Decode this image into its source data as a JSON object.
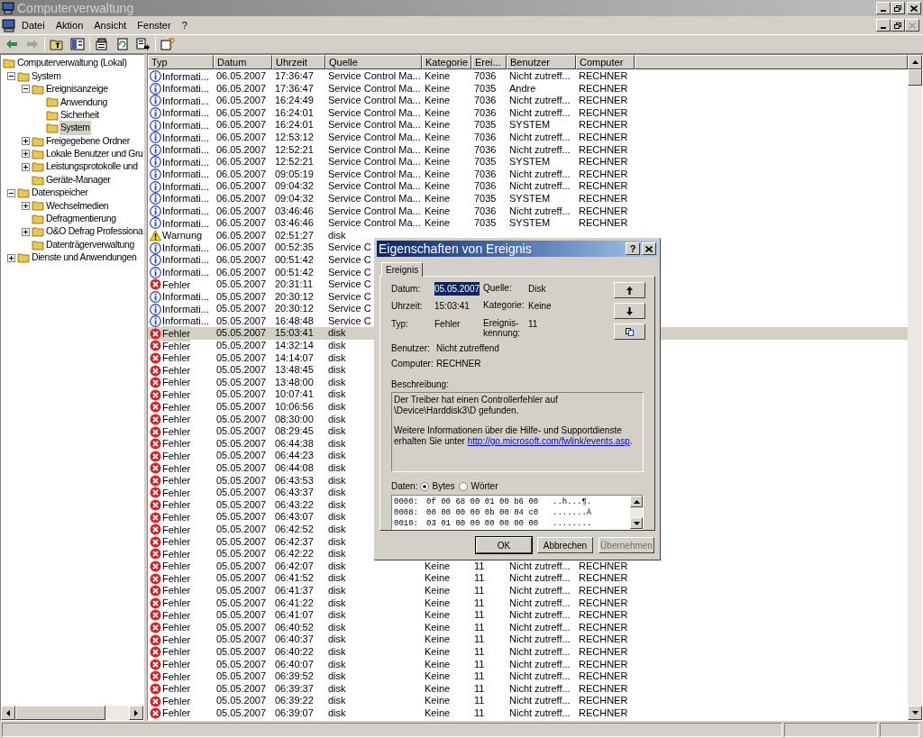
{
  "window": {
    "title": "Computerverwaltung"
  },
  "menu": [
    "Datei",
    "Aktion",
    "Ansicht",
    "Fenster",
    "?"
  ],
  "tree": [
    {
      "label": "Computerverwaltung (Lokal)",
      "selected": false,
      "children": [
        {
          "label": "System",
          "selected": false,
          "expanded": true,
          "children": [
            {
              "label": "Ereignisanzeige",
              "selected": false,
              "expanded": true,
              "children": [
                {
                  "label": "Anwendung",
                  "selected": false
                },
                {
                  "label": "Sicherheit",
                  "selected": false
                },
                {
                  "label": "System",
                  "selected": true
                }
              ]
            },
            {
              "label": "Freigegebene Ordner",
              "selected": false,
              "expanded": false
            },
            {
              "label": "Lokale Benutzer und Gru",
              "selected": false,
              "expanded": false
            },
            {
              "label": "Leistungsprotokolle und",
              "selected": false,
              "expanded": false
            },
            {
              "label": "Geräte-Manager",
              "selected": false
            }
          ]
        },
        {
          "label": "Datenspeicher",
          "selected": false,
          "expanded": true,
          "children": [
            {
              "label": "Wechselmedien",
              "selected": false,
              "expanded": false
            },
            {
              "label": "Defragmentierung",
              "selected": false
            },
            {
              "label": "O&O Defrag Professiona",
              "selected": false,
              "expanded": false
            },
            {
              "label": "Datenträgerverwaltung",
              "selected": false
            }
          ]
        },
        {
          "label": "Dienste und Anwendungen",
          "selected": false,
          "expanded": false
        }
      ]
    }
  ],
  "table": {
    "columns": [
      "Typ",
      "Datum",
      "Uhrzeit",
      "Quelle",
      "Kategorie",
      "Erei...",
      "Benutzer",
      "Computer"
    ],
    "rows": [
      {
        "kind": "info",
        "typ": "Informati...",
        "datum": "06.05.2007",
        "uhrzeit": "17:36:47",
        "quelle": "Service Control Ma...",
        "kategorie": "Keine",
        "ereignis": "7036",
        "benutzer": "Nicht zutreff...",
        "computer": "RECHNER",
        "selected": false
      },
      {
        "kind": "info",
        "typ": "Informati...",
        "datum": "06.05.2007",
        "uhrzeit": "17:36:47",
        "quelle": "Service Control Ma...",
        "kategorie": "Keine",
        "ereignis": "7035",
        "benutzer": "Andre",
        "computer": "RECHNER",
        "selected": false
      },
      {
        "kind": "info",
        "typ": "Informati...",
        "datum": "06.05.2007",
        "uhrzeit": "16:24:49",
        "quelle": "Service Control Ma...",
        "kategorie": "Keine",
        "ereignis": "7036",
        "benutzer": "Nicht zutreff...",
        "computer": "RECHNER",
        "selected": false
      },
      {
        "kind": "info",
        "typ": "Informati...",
        "datum": "06.05.2007",
        "uhrzeit": "16:24:01",
        "quelle": "Service Control Ma...",
        "kategorie": "Keine",
        "ereignis": "7036",
        "benutzer": "Nicht zutreff...",
        "computer": "RECHNER",
        "selected": false
      },
      {
        "kind": "info",
        "typ": "Informati...",
        "datum": "06.05.2007",
        "uhrzeit": "16:24:01",
        "quelle": "Service Control Ma...",
        "kategorie": "Keine",
        "ereignis": "7035",
        "benutzer": "SYSTEM",
        "computer": "RECHNER",
        "selected": false
      },
      {
        "kind": "info",
        "typ": "Informati...",
        "datum": "06.05.2007",
        "uhrzeit": "12:53:12",
        "quelle": "Service Control Ma...",
        "kategorie": "Keine",
        "ereignis": "7036",
        "benutzer": "Nicht zutreff...",
        "computer": "RECHNER",
        "selected": false
      },
      {
        "kind": "info",
        "typ": "Informati...",
        "datum": "06.05.2007",
        "uhrzeit": "12:52:21",
        "quelle": "Service Control Ma...",
        "kategorie": "Keine",
        "ereignis": "7036",
        "benutzer": "Nicht zutreff...",
        "computer": "RECHNER",
        "selected": false
      },
      {
        "kind": "info",
        "typ": "Informati...",
        "datum": "06.05.2007",
        "uhrzeit": "12:52:21",
        "quelle": "Service Control Ma...",
        "kategorie": "Keine",
        "ereignis": "7035",
        "benutzer": "SYSTEM",
        "computer": "RECHNER",
        "selected": false
      },
      {
        "kind": "info",
        "typ": "Informati...",
        "datum": "06.05.2007",
        "uhrzeit": "09:05:19",
        "quelle": "Service Control Ma...",
        "kategorie": "Keine",
        "ereignis": "7036",
        "benutzer": "Nicht zutreff...",
        "computer": "RECHNER",
        "selected": false
      },
      {
        "kind": "info",
        "typ": "Informati...",
        "datum": "06.05.2007",
        "uhrzeit": "09:04:32",
        "quelle": "Service Control Ma...",
        "kategorie": "Keine",
        "ereignis": "7036",
        "benutzer": "Nicht zutreff...",
        "computer": "RECHNER",
        "selected": false
      },
      {
        "kind": "info",
        "typ": "Informati...",
        "datum": "06.05.2007",
        "uhrzeit": "09:04:32",
        "quelle": "Service Control Ma...",
        "kategorie": "Keine",
        "ereignis": "7035",
        "benutzer": "SYSTEM",
        "computer": "RECHNER",
        "selected": false
      },
      {
        "kind": "info",
        "typ": "Informati...",
        "datum": "06.05.2007",
        "uhrzeit": "03:46:46",
        "quelle": "Service Control Ma...",
        "kategorie": "Keine",
        "ereignis": "7036",
        "benutzer": "Nicht zutreff...",
        "computer": "RECHNER",
        "selected": false
      },
      {
        "kind": "info",
        "typ": "Informati...",
        "datum": "06.05.2007",
        "uhrzeit": "03:46:46",
        "quelle": "Service Control Ma...",
        "kategorie": "Keine",
        "ereignis": "7035",
        "benutzer": "SYSTEM",
        "computer": "RECHNER",
        "selected": false
      },
      {
        "kind": "warning",
        "typ": "Warnung",
        "datum": "06.05.2007",
        "uhrzeit": "02:51:27",
        "quelle": "disk",
        "selected": false
      },
      {
        "kind": "info",
        "typ": "Informati...",
        "datum": "06.05.2007",
        "uhrzeit": "00:52:35",
        "quelle": "Service C",
        "selected": false
      },
      {
        "kind": "info",
        "typ": "Informati...",
        "datum": "06.05.2007",
        "uhrzeit": "00:51:42",
        "quelle": "Service C",
        "selected": false
      },
      {
        "kind": "info",
        "typ": "Informati...",
        "datum": "06.05.2007",
        "uhrzeit": "00:51:42",
        "quelle": "Service C",
        "selected": false
      },
      {
        "kind": "error",
        "typ": "Fehler",
        "datum": "05.05.2007",
        "uhrzeit": "20:31:11",
        "quelle": "Service C",
        "selected": false
      },
      {
        "kind": "info",
        "typ": "Informati...",
        "datum": "05.05.2007",
        "uhrzeit": "20:30:12",
        "quelle": "Service C",
        "selected": false
      },
      {
        "kind": "info",
        "typ": "Informati...",
        "datum": "05.05.2007",
        "uhrzeit": "20:30:12",
        "quelle": "Service C",
        "selected": false
      },
      {
        "kind": "info",
        "typ": "Informati...",
        "datum": "05.05.2007",
        "uhrzeit": "16:48:48",
        "quelle": "Service C",
        "selected": false
      },
      {
        "kind": "error",
        "typ": "Fehler",
        "datum": "05.05.2007",
        "uhrzeit": "15:03:41",
        "quelle": "disk",
        "selected": true
      },
      {
        "kind": "error",
        "typ": "Fehler",
        "datum": "05.05.2007",
        "uhrzeit": "14:32:14",
        "quelle": "disk",
        "selected": false
      },
      {
        "kind": "error",
        "typ": "Fehler",
        "datum": "05.05.2007",
        "uhrzeit": "14:14:07",
        "quelle": "disk",
        "selected": false
      },
      {
        "kind": "error",
        "typ": "Fehler",
        "datum": "05.05.2007",
        "uhrzeit": "13:48:45",
        "quelle": "disk",
        "selected": false
      },
      {
        "kind": "error",
        "typ": "Fehler",
        "datum": "05.05.2007",
        "uhrzeit": "13:48:00",
        "quelle": "disk",
        "selected": false
      },
      {
        "kind": "error",
        "typ": "Fehler",
        "datum": "05.05.2007",
        "uhrzeit": "10:07:41",
        "quelle": "disk",
        "selected": false
      },
      {
        "kind": "error",
        "typ": "Fehler",
        "datum": "05.05.2007",
        "uhrzeit": "10:06:56",
        "quelle": "disk",
        "selected": false
      },
      {
        "kind": "error",
        "typ": "Fehler",
        "datum": "05.05.2007",
        "uhrzeit": "08:30:00",
        "quelle": "disk",
        "selected": false
      },
      {
        "kind": "error",
        "typ": "Fehler",
        "datum": "05.05.2007",
        "uhrzeit": "08:29:45",
        "quelle": "disk",
        "selected": false
      },
      {
        "kind": "error",
        "typ": "Fehler",
        "datum": "05.05.2007",
        "uhrzeit": "06:44:38",
        "quelle": "disk",
        "selected": false
      },
      {
        "kind": "error",
        "typ": "Fehler",
        "datum": "05.05.2007",
        "uhrzeit": "06:44:23",
        "quelle": "disk",
        "selected": false
      },
      {
        "kind": "error",
        "typ": "Fehler",
        "datum": "05.05.2007",
        "uhrzeit": "06:44:08",
        "quelle": "disk",
        "selected": false
      },
      {
        "kind": "error",
        "typ": "Fehler",
        "datum": "05.05.2007",
        "uhrzeit": "06:43:53",
        "quelle": "disk",
        "selected": false
      },
      {
        "kind": "error",
        "typ": "Fehler",
        "datum": "05.05.2007",
        "uhrzeit": "06:43:37",
        "quelle": "disk",
        "selected": false
      },
      {
        "kind": "error",
        "typ": "Fehler",
        "datum": "05.05.2007",
        "uhrzeit": "06:43:22",
        "quelle": "disk",
        "selected": false
      },
      {
        "kind": "error",
        "typ": "Fehler",
        "datum": "05.05.2007",
        "uhrzeit": "06:43:07",
        "quelle": "disk",
        "selected": false
      },
      {
        "kind": "error",
        "typ": "Fehler",
        "datum": "05.05.2007",
        "uhrzeit": "06:42:52",
        "quelle": "disk",
        "selected": false
      },
      {
        "kind": "error",
        "typ": "Fehler",
        "datum": "05.05.2007",
        "uhrzeit": "06:42:37",
        "quelle": "disk",
        "selected": false
      },
      {
        "kind": "error",
        "typ": "Fehler",
        "datum": "05.05.2007",
        "uhrzeit": "06:42:22",
        "quelle": "disk",
        "selected": false
      },
      {
        "kind": "error",
        "typ": "Fehler",
        "datum": "05.05.2007",
        "uhrzeit": "06:42:07",
        "quelle": "disk",
        "kategorie": "Keine",
        "ereignis": "11",
        "benutzer": "Nicht zutreff...",
        "computer": "RECHNER",
        "selected": false
      },
      {
        "kind": "error",
        "typ": "Fehler",
        "datum": "05.05.2007",
        "uhrzeit": "06:41:52",
        "quelle": "disk",
        "kategorie": "Keine",
        "ereignis": "11",
        "benutzer": "Nicht zutreff...",
        "computer": "RECHNER",
        "selected": false
      },
      {
        "kind": "error",
        "typ": "Fehler",
        "datum": "05.05.2007",
        "uhrzeit": "06:41:37",
        "quelle": "disk",
        "kategorie": "Keine",
        "ereignis": "11",
        "benutzer": "Nicht zutreff...",
        "computer": "RECHNER",
        "selected": false
      },
      {
        "kind": "error",
        "typ": "Fehler",
        "datum": "05.05.2007",
        "uhrzeit": "06:41:22",
        "quelle": "disk",
        "kategorie": "Keine",
        "ereignis": "11",
        "benutzer": "Nicht zutreff...",
        "computer": "RECHNER",
        "selected": false
      },
      {
        "kind": "error",
        "typ": "Fehler",
        "datum": "05.05.2007",
        "uhrzeit": "06:41:07",
        "quelle": "disk",
        "kategorie": "Keine",
        "ereignis": "11",
        "benutzer": "Nicht zutreff...",
        "computer": "RECHNER",
        "selected": false
      },
      {
        "kind": "error",
        "typ": "Fehler",
        "datum": "05.05.2007",
        "uhrzeit": "06:40:52",
        "quelle": "disk",
        "kategorie": "Keine",
        "ereignis": "11",
        "benutzer": "Nicht zutreff...",
        "computer": "RECHNER",
        "selected": false
      },
      {
        "kind": "error",
        "typ": "Fehler",
        "datum": "05.05.2007",
        "uhrzeit": "06:40:37",
        "quelle": "disk",
        "kategorie": "Keine",
        "ereignis": "11",
        "benutzer": "Nicht zutreff...",
        "computer": "RECHNER",
        "selected": false
      },
      {
        "kind": "error",
        "typ": "Fehler",
        "datum": "05.05.2007",
        "uhrzeit": "06:40:22",
        "quelle": "disk",
        "kategorie": "Keine",
        "ereignis": "11",
        "benutzer": "Nicht zutreff...",
        "computer": "RECHNER",
        "selected": false
      },
      {
        "kind": "error",
        "typ": "Fehler",
        "datum": "05.05.2007",
        "uhrzeit": "06:40:07",
        "quelle": "disk",
        "kategorie": "Keine",
        "ereignis": "11",
        "benutzer": "Nicht zutreff...",
        "computer": "RECHNER",
        "selected": false
      },
      {
        "kind": "error",
        "typ": "Fehler",
        "datum": "05.05.2007",
        "uhrzeit": "06:39:52",
        "quelle": "disk",
        "kategorie": "Keine",
        "ereignis": "11",
        "benutzer": "Nicht zutreff...",
        "computer": "RECHNER",
        "selected": false
      },
      {
        "kind": "error",
        "typ": "Fehler",
        "datum": "05.05.2007",
        "uhrzeit": "06:39:37",
        "quelle": "disk",
        "kategorie": "Keine",
        "ereignis": "11",
        "benutzer": "Nicht zutreff...",
        "computer": "RECHNER",
        "selected": false
      },
      {
        "kind": "error",
        "typ": "Fehler",
        "datum": "05.05.2007",
        "uhrzeit": "06:39:22",
        "quelle": "disk",
        "kategorie": "Keine",
        "ereignis": "11",
        "benutzer": "Nicht zutreff...",
        "computer": "RECHNER",
        "selected": false
      },
      {
        "kind": "error",
        "typ": "Fehler",
        "datum": "05.05.2007",
        "uhrzeit": "06:39:07",
        "quelle": "disk",
        "kategorie": "Keine",
        "ereignis": "11",
        "benutzer": "Nicht zutreff...",
        "computer": "RECHNER",
        "selected": false
      }
    ]
  },
  "dialog": {
    "title": "Eigenschaften von Ereignis",
    "help": "?",
    "tabs": [
      {
        "label": "Ereignis",
        "selected": true
      }
    ],
    "left_fields": [
      {
        "label": "Datum:",
        "value": "05.05.2007",
        "highlighted": true
      },
      {
        "label": "Uhrzeit:",
        "value": "15:03:41",
        "highlighted": false
      },
      {
        "label": "Typ:",
        "value": "Fehler",
        "highlighted": false
      }
    ],
    "right_fields": [
      {
        "label": "Quelle:",
        "value": "Disk"
      },
      {
        "label": "Kategorie:",
        "value": "Keine"
      },
      {
        "label": "Ereignis-kennung:",
        "value": "11"
      }
    ],
    "fields": [
      {
        "label": "Benutzer:",
        "value": "Nicht zutreffend"
      },
      {
        "label": "Computer:",
        "value": "RECHNER"
      }
    ],
    "description_label": "Beschreibung:",
    "description": [
      {
        "text": "Der Treiber hat einen Controllerfehler auf \\Device\\Harddisk3\\D gefunden."
      },
      {
        "text": "Weitere Informationen über die Hilfe- und Supportdienste erhalten Sie unter ",
        "link": "http://go.microsoft.com/fwlink/events.asp",
        "after": "."
      }
    ],
    "data_label": "Daten:",
    "data_format": [
      {
        "label": "Bytes",
        "selected": true
      },
      {
        "label": "Wörter",
        "selected": false
      }
    ],
    "hex_rows": [
      {
        "offset": "0000:",
        "bytes": "0f 00 68 00 01 00 b6 00",
        "chars": "..h...¶."
      },
      {
        "offset": "0008:",
        "bytes": "00 00 00 00 0b 00 04 c0",
        "chars": ".......À"
      },
      {
        "offset": "0010:",
        "bytes": "03 01 00 00 00 00 00 00",
        "chars": "........"
      }
    ],
    "buttons": [
      {
        "label": "OK",
        "disabled": false
      },
      {
        "label": "Abbrechen",
        "disabled": false
      },
      {
        "label": "Übernehmen",
        "disabled": true
      }
    ]
  }
}
